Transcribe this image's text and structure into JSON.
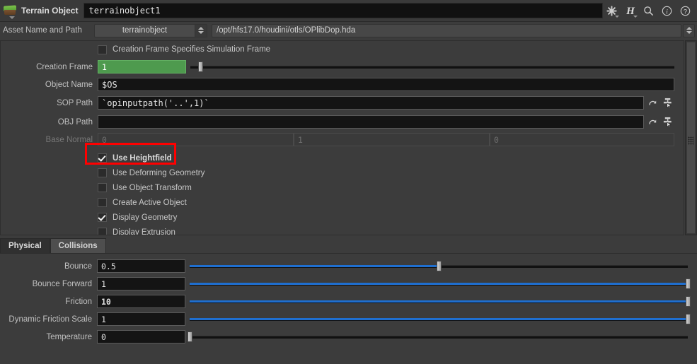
{
  "titlebar": {
    "node_icon": "terrain-block-icon",
    "node_type": "Terrain Object",
    "node_name": "terrainobject1",
    "icons": [
      {
        "name": "gear-icon",
        "glyph": "gear"
      },
      {
        "name": "houdini-logo-icon",
        "glyph": "H"
      },
      {
        "name": "search-icon",
        "glyph": "magnifier"
      },
      {
        "name": "info-icon",
        "glyph": "i"
      },
      {
        "name": "help-icon",
        "glyph": "?"
      }
    ]
  },
  "asset_row": {
    "label": "Asset Name and Path",
    "asset_name": "terrainobject",
    "asset_path": "/opt/hfs17.0/houdini/otls/OPlibDop.hda"
  },
  "main": {
    "creation_frame_sim": {
      "label": "Creation Frame Specifies Simulation Frame",
      "checked": false
    },
    "creation_frame": {
      "label": "Creation Frame",
      "value": "1",
      "slider_pct": 2,
      "fill_pct": 0,
      "animated": true
    },
    "object_name": {
      "label": "Object Name",
      "value": "$OS"
    },
    "sop_path": {
      "label": "SOP Path",
      "value": "`opinputpath('..',1)`",
      "reload_icon": "reload-icon",
      "chooser_icon": "node-chooser-icon"
    },
    "obj_path": {
      "label": "OBJ Path",
      "value": "",
      "reload_icon": "reload-icon",
      "chooser_icon": "node-chooser-icon"
    },
    "base_normal": {
      "label": "Base Normal",
      "disabled": true,
      "values": [
        "0",
        "1",
        "0"
      ]
    },
    "toggles": [
      {
        "label": "Use Heightfield",
        "checked": true,
        "highlighted": true
      },
      {
        "label": "Use Deforming Geometry",
        "checked": false,
        "highlighted": false
      },
      {
        "label": "Use Object Transform",
        "checked": false,
        "highlighted": false
      },
      {
        "label": "Create Active Object",
        "checked": false,
        "highlighted": false
      },
      {
        "label": "Display Geometry",
        "checked": true,
        "highlighted": false
      },
      {
        "label": "Display Extrusion",
        "checked": false,
        "highlighted": false
      }
    ]
  },
  "tabs": [
    {
      "label": "Physical",
      "active": true
    },
    {
      "label": "Collisions",
      "active": false
    }
  ],
  "physical": {
    "params": [
      {
        "label": "Bounce",
        "value": "0.5",
        "bold": false,
        "fill_pct": 50,
        "handle_pct": 50
      },
      {
        "label": "Bounce Forward",
        "value": "1",
        "bold": false,
        "fill_pct": 100,
        "handle_pct": 100
      },
      {
        "label": "Friction",
        "value": "10",
        "bold": true,
        "fill_pct": 100,
        "handle_pct": 100
      },
      {
        "label": "Dynamic Friction Scale",
        "value": "1",
        "bold": false,
        "fill_pct": 100,
        "handle_pct": 100
      },
      {
        "label": "Temperature",
        "value": "0",
        "bold": false,
        "fill_pct": 0,
        "handle_pct": 0
      }
    ]
  },
  "colors": {
    "background": "#3c3c3c",
    "field_bg": "#141414",
    "animated_green": "#4e9a4e",
    "slider_blue": "#1f6fd0",
    "highlight_red": "#ff0000",
    "text": "#c8c8c8"
  }
}
